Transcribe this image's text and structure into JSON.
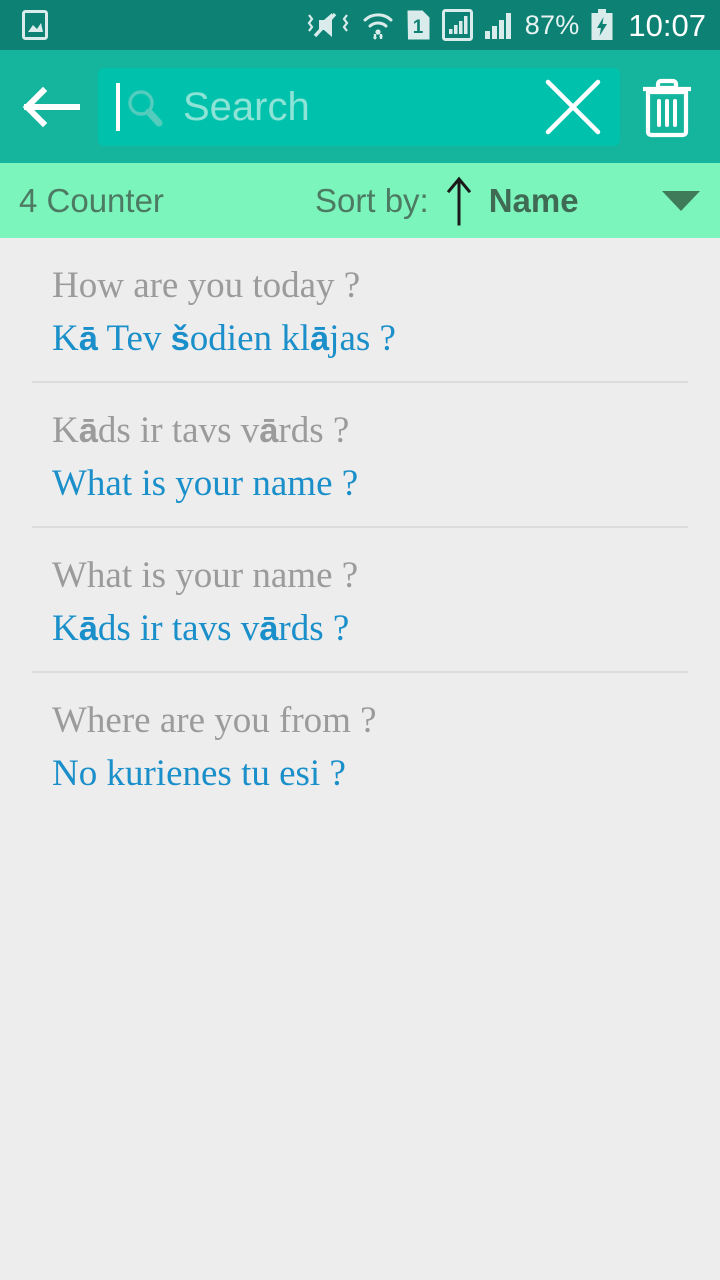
{
  "statusbar": {
    "time": "10:07",
    "battery_percent": "87%",
    "sim_badge": "1",
    "icons": [
      "image-icon",
      "volume-mute-vibrate-icon",
      "wifi-icon",
      "sim-card-1-icon",
      "signal-bars-1-icon",
      "signal-bars-2-icon",
      "battery-charging-icon"
    ]
  },
  "toolbar": {
    "back_label": "Back",
    "search_value": "",
    "search_placeholder": "Search",
    "clear_label": "Clear",
    "delete_label": "Delete",
    "icons": {
      "back": "arrow-left-icon",
      "search": "search-icon",
      "clear": "close-icon",
      "delete": "trash-icon"
    }
  },
  "sortbar": {
    "counter": "4 Counter",
    "sort_by_label": "Sort by:",
    "sort_direction": "ascending",
    "sort_value": "Name",
    "dropdown_icon": "chevron-down-icon",
    "direction_icon": "arrow-up-icon"
  },
  "colors": {
    "statusbar_bg": "#0d8274",
    "toolbar_bg": "#15b49c",
    "searchbox_bg": "#00c2ac",
    "sortbar_bg": "#7cf5bc",
    "list_bg": "#ededed",
    "divider": "#dcdcdc",
    "source_text": "#9b9b9b",
    "target_text": "#1a8fc9",
    "sortbar_text": "#4c7a62"
  },
  "list": {
    "items": [
      {
        "source": "How are you today ?",
        "target_pre": "K",
        "target_fb": "ā",
        "target_post": " Tev šodien klājas ?",
        "target": "Kā Tev šodien klājas ?"
      },
      {
        "source": "Kāds ir tavs vārds ?",
        "target": "What is your name ?"
      },
      {
        "source": "What is your name ?",
        "target": "Kāds ir tavs vārds ?"
      },
      {
        "source": "Where are you from ?",
        "target": "No kurienes tu esi ?"
      }
    ]
  }
}
